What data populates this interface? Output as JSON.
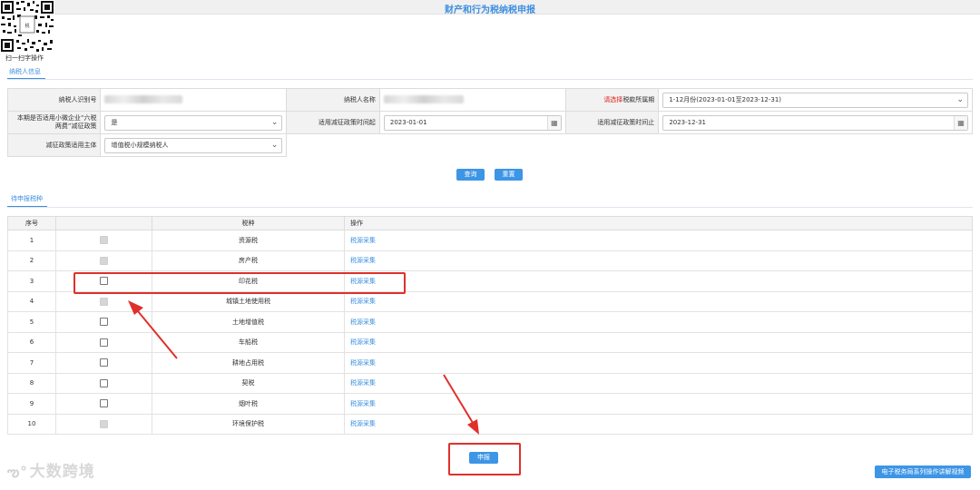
{
  "header": {
    "title": "财产和行为税纳税申报"
  },
  "qr": {
    "caption": "扫一扫字操作"
  },
  "taxpayer_tab": {
    "label": "纳税人信息"
  },
  "form": {
    "taxpayer_id_label": "纳税人识别号",
    "taxpayer_name_label": "纳税人名称",
    "period_label_red": "请选择",
    "period_label_rest": "税款所属期",
    "period_value": "1-12月份(2023-01-01至2023-12-31)",
    "small_biz_label": "本期是否适用小微企业“六税两费”减征政策",
    "small_biz_value": "是",
    "policy_start_label": "适用减征政策时间起",
    "policy_start_value": "2023-01-01",
    "policy_end_label": "适用减征政策时间止",
    "policy_end_value": "2023-12-31",
    "subject_label": "减征政策适用主体",
    "subject_value": "增值税小规模纳税人"
  },
  "actions": {
    "query": "查询",
    "reset": "重置"
  },
  "pending_tab": {
    "label": "待申报税种"
  },
  "table": {
    "columns": [
      "序号",
      "",
      "税种",
      "操作"
    ],
    "rows": [
      {
        "no": "1",
        "tax": "资源税",
        "action": "税源采集",
        "checkbox": "disabled"
      },
      {
        "no": "2",
        "tax": "房产税",
        "action": "税源采集",
        "checkbox": "disabled"
      },
      {
        "no": "3",
        "tax": "印花税",
        "action": "税源采集",
        "checkbox": "unchecked"
      },
      {
        "no": "4",
        "tax": "城镇土地使用税",
        "action": "税源采集",
        "checkbox": "disabled"
      },
      {
        "no": "5",
        "tax": "土地增值税",
        "action": "税源采集",
        "checkbox": "unchecked"
      },
      {
        "no": "6",
        "tax": "车船税",
        "action": "税源采集",
        "checkbox": "unchecked"
      },
      {
        "no": "7",
        "tax": "耕地占用税",
        "action": "税源采集",
        "checkbox": "unchecked"
      },
      {
        "no": "8",
        "tax": "契税",
        "action": "税源采集",
        "checkbox": "unchecked"
      },
      {
        "no": "9",
        "tax": "烟叶税",
        "action": "税源采集",
        "checkbox": "unchecked"
      },
      {
        "no": "10",
        "tax": "环境保护税",
        "action": "税源采集",
        "checkbox": "disabled"
      }
    ]
  },
  "submit": {
    "label": "申报"
  },
  "help": {
    "label": "电子税务局系列操作讲解视频"
  },
  "watermark": {
    "text": "大数跨境"
  },
  "colors": {
    "accent": "#3d95e6",
    "highlight": "#e0302a"
  }
}
